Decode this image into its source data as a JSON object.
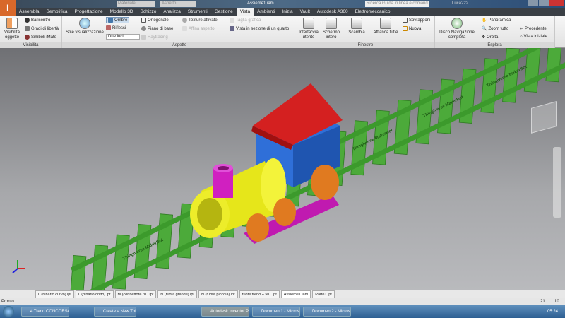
{
  "titlebar": {
    "document": "Assieme1.iam",
    "material": "Materiale",
    "appearance": "Aspetto",
    "search_placeholder": "Ricerca Guida in linea e comand",
    "user": "Luca222"
  },
  "tabs": [
    "Assembla",
    "Semplifica",
    "Progettazione",
    "Modello 3D",
    "Schizzo",
    "Analizza",
    "Strumenti",
    "Gestione",
    "Vista",
    "Ambienti",
    "Inizia",
    "Vault",
    "Autodesk A360",
    "Elettromeccanico"
  ],
  "active_tab": "Vista",
  "ribbon": {
    "visibility": {
      "label": "Visibilità",
      "object": "Visibilità oggetto",
      "items": [
        "Baricentro",
        "Gradi di libertà",
        "Simboli iMate"
      ]
    },
    "aspect": {
      "label": "Aspetto",
      "style": "Stile visualizzazione",
      "shadows": "Ombre",
      "reflections": "Riflessi",
      "lights": "Due luci",
      "orthographic": "Ortogonale",
      "ground_plane": "Piano di base",
      "raytracing": "Raytracing",
      "textures": "Texture attivate",
      "refine": "Affina aspetto",
      "section": "Taglia grafica",
      "quarter_section": "Vista in sezione di un quarto"
    },
    "windows": {
      "label": "Finestre",
      "ui": "Interfaccia utente",
      "fullscreen": "Schermo intero",
      "switch": "Scambia",
      "tile": "Affianca tutte",
      "cascade": "Sovrapponi",
      "new": "Nuova"
    },
    "navigate": {
      "label": "Esplora",
      "wheel": "Disco Navigazione completa",
      "pan": "Panoramica",
      "zoom": "Zoom tutto",
      "orbit": "Orbita",
      "previous": "Precedente",
      "home": "Vista iniziale"
    }
  },
  "document_tabs": [
    "L (binario curvo).ipt",
    "L (binario dritto).ipt",
    "M (connettore ru...ipt",
    "N (ruota grande).ipt",
    "N (ruota piccola).ipt",
    "ruote treno + tel...ipt",
    "Assieme1.iam",
    "Parte1.ipt"
  ],
  "active_document": "Assieme1.iam",
  "status": {
    "text": "Pronto",
    "count1": "21",
    "count2": "10"
  },
  "taskbar": {
    "items": [
      "4 Treno CONCORSO",
      "Create a New Thing ...",
      "Autodesk Inventor Pr...",
      "Document1 - Micros...",
      "Document2 - Micros..."
    ],
    "clock": "05:24"
  },
  "track_text": "Thingiverse MakerBot",
  "colors": {
    "track": "#4caa3a",
    "boiler": "#e6e61a",
    "cab": "#2f6fd8",
    "roof": "#d42020",
    "chimney": "#d020c0",
    "wheels": "#e07a20"
  }
}
